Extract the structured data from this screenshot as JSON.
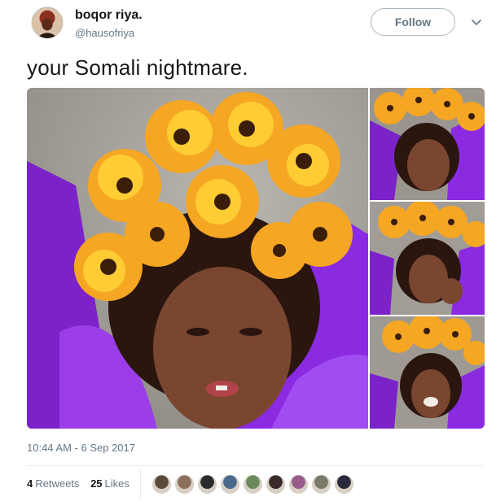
{
  "user": {
    "display_name": "boqor riya.",
    "handle": "@hausofriya"
  },
  "actions": {
    "follow_label": "Follow",
    "more_icon": "chevron-down-icon"
  },
  "tweet": {
    "text": "your Somali nightmare.",
    "timestamp": "10:44 AM - 6 Sep 2017"
  },
  "stats": {
    "retweets_count": "4",
    "retweets_label": "Retweets",
    "likes_count": "25",
    "likes_label": "Likes"
  },
  "likers": [
    {
      "name": "liker-1",
      "color": "#5a4a3a"
    },
    {
      "name": "liker-2",
      "color": "#8c6f5a"
    },
    {
      "name": "liker-3",
      "color": "#2b2b2b"
    },
    {
      "name": "liker-4",
      "color": "#4a6a8a"
    },
    {
      "name": "liker-5",
      "color": "#6a8a5a"
    },
    {
      "name": "liker-6",
      "color": "#3a2a2a"
    },
    {
      "name": "liker-7",
      "color": "#9a5a8a"
    },
    {
      "name": "liker-8",
      "color": "#7a7a6a"
    },
    {
      "name": "liker-9",
      "color": "#2a2a3a"
    }
  ],
  "colors": {
    "purple": "#8a2be2",
    "flower_yellow": "#f5a623",
    "secondary_text": "#657786"
  }
}
